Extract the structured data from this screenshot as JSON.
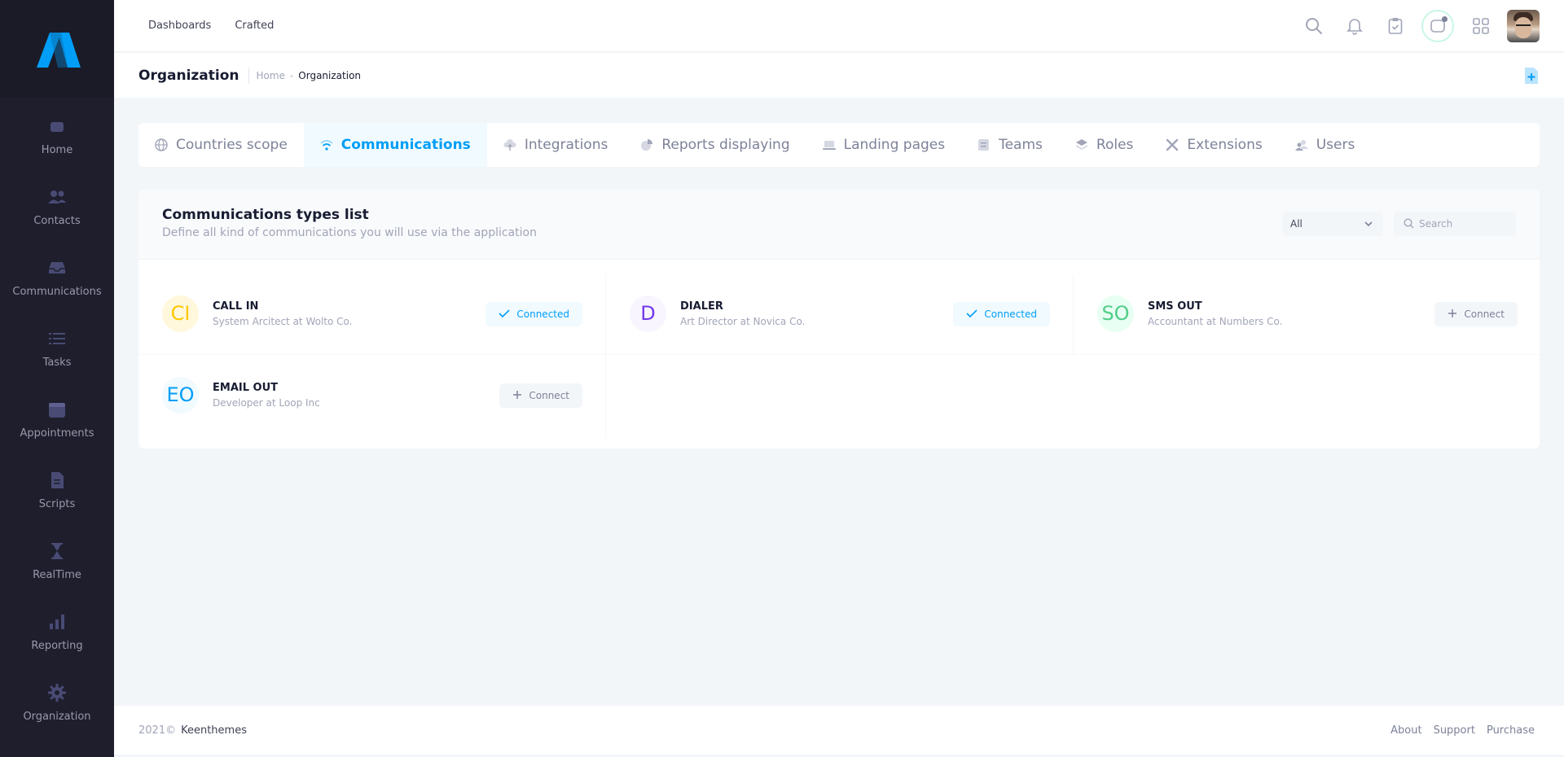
{
  "sidebar": {
    "items": [
      {
        "label": "Home",
        "icon": "home-icon"
      },
      {
        "label": "Contacts",
        "icon": "contacts-icon"
      },
      {
        "label": "Communications",
        "icon": "inbox-icon"
      },
      {
        "label": "Tasks",
        "icon": "tasks-icon"
      },
      {
        "label": "Appointments",
        "icon": "calendar-icon"
      },
      {
        "label": "Scripts",
        "icon": "document-icon"
      },
      {
        "label": "RealTime",
        "icon": "hourglass-icon"
      },
      {
        "label": "Reporting",
        "icon": "bar-chart-icon"
      },
      {
        "label": "Organization",
        "icon": "gear-icon"
      }
    ]
  },
  "header": {
    "links": [
      "Dashboards",
      "Crafted"
    ]
  },
  "toolbar": {
    "title": "Organization",
    "breadcrumb": [
      "Home",
      "Organization"
    ]
  },
  "tabs": [
    {
      "label": "Countries scope",
      "icon": "globe-icon",
      "active": false
    },
    {
      "label": "Communications",
      "icon": "wifi-icon",
      "active": true
    },
    {
      "label": "Integrations",
      "icon": "cloud-upload-icon",
      "active": false
    },
    {
      "label": "Reports displaying",
      "icon": "pie-chart-icon",
      "active": false
    },
    {
      "label": "Landing pages",
      "icon": "laptop-icon",
      "active": false
    },
    {
      "label": "Teams",
      "icon": "teams-icon",
      "active": false
    },
    {
      "label": "Roles",
      "icon": "layers-icon",
      "active": false
    },
    {
      "label": "Extensions",
      "icon": "extensions-icon",
      "active": false
    },
    {
      "label": "Users",
      "icon": "users-icon",
      "active": false
    }
  ],
  "card": {
    "title": "Communications types list",
    "subtitle": "Define all kind of communications you will use via the application",
    "filter": {
      "selected": "All"
    },
    "search": {
      "placeholder": "Search",
      "value": ""
    }
  },
  "items": [
    {
      "symbol": "CI",
      "name": "CALL IN",
      "role": "System Arcitect at Wolto Co.",
      "status": "Connected",
      "symbol_color": "#ffc700",
      "symbol_bg": "#fff8dd"
    },
    {
      "symbol": "D",
      "name": "DIALER",
      "role": "Art Director at Novica Co.",
      "status": "Connected",
      "symbol_color": "#7239ea",
      "symbol_bg": "#f8f5ff"
    },
    {
      "symbol": "SO",
      "name": "SMS OUT",
      "role": "Accountant at Numbers Co.",
      "status": "Connect",
      "symbol_color": "#50cd89",
      "symbol_bg": "#e8fff3"
    },
    {
      "symbol": "EO",
      "name": "EMAIL OUT",
      "role": "Developer at Loop Inc",
      "status": "Connect",
      "symbol_color": "#009ef7",
      "symbol_bg": "#f1faff"
    }
  ],
  "footer": {
    "year": "2021©",
    "brand": "Keenthemes",
    "links": [
      "About",
      "Support",
      "Purchase"
    ]
  },
  "colors": {
    "primary": "#009ef7",
    "sidebar_bg": "#1e1e2d",
    "page_bg": "#f3f6f9"
  }
}
